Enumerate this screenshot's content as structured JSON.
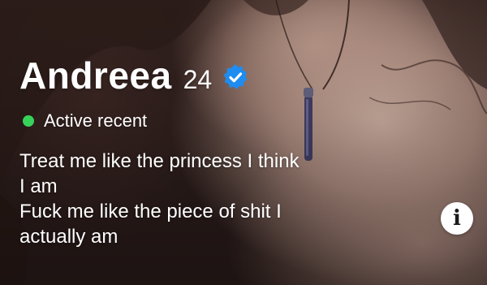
{
  "profile": {
    "name": "Andreea",
    "age": "24",
    "verified_icon": "verified-check-badge",
    "status_text": "Active recent",
    "status_color": "#37d25a",
    "bio_lines": [
      "Treat me like the princess I think",
      "I am",
      "Fuck me like the piece of shit I",
      "actually am"
    ]
  },
  "controls": {
    "info_icon": "info-icon",
    "info_label": "i"
  },
  "colors": {
    "verified_blue": "#1e8cf0",
    "text": "#ffffff"
  }
}
